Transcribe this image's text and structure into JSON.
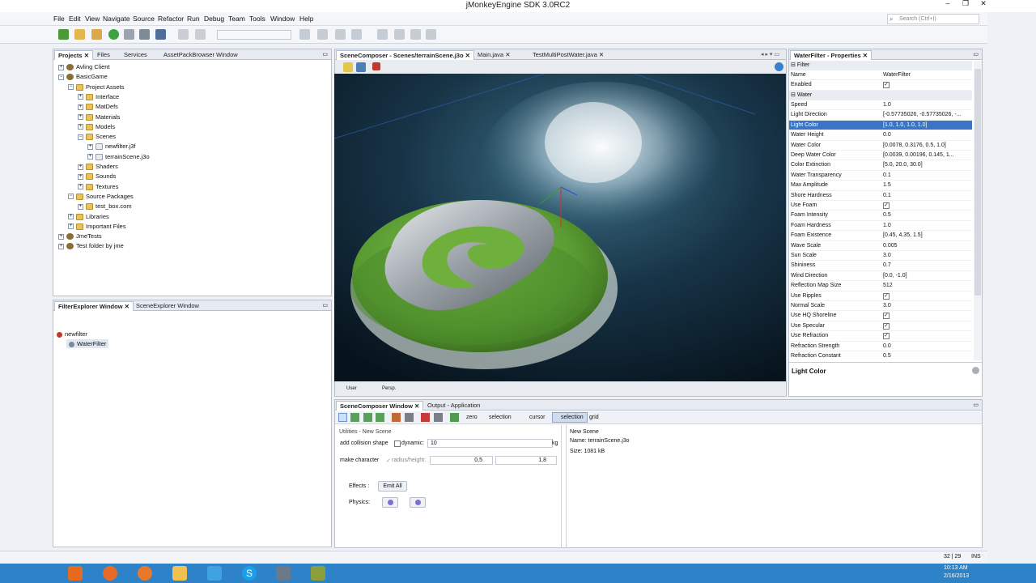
{
  "window": {
    "title": "jMonkeyEngine SDK 3.0RC2",
    "search_placeholder": "Search (Ctrl+I)"
  },
  "menu": [
    "File",
    "Edit",
    "View",
    "Navigate",
    "Source",
    "Refactor",
    "Run",
    "Debug",
    "Team",
    "Tools",
    "Window",
    "Help"
  ],
  "projects": {
    "tabs": [
      "Projects",
      "Files",
      "Services",
      "AssetPackBrowser Window"
    ],
    "tree": [
      {
        "label": "Avling Client",
        "depth": 0,
        "type": "proj",
        "tg": "+"
      },
      {
        "label": "BasicGame",
        "depth": 0,
        "type": "proj",
        "tg": "−"
      },
      {
        "label": "Project Assets",
        "depth": 1,
        "type": "folder",
        "tg": "−"
      },
      {
        "label": "Interface",
        "depth": 2,
        "type": "folder",
        "tg": "+"
      },
      {
        "label": "MatDefs",
        "depth": 2,
        "type": "folder",
        "tg": "+"
      },
      {
        "label": "Materials",
        "depth": 2,
        "type": "folder",
        "tg": "+"
      },
      {
        "label": "Models",
        "depth": 2,
        "type": "folder",
        "tg": "+"
      },
      {
        "label": "Scenes",
        "depth": 2,
        "type": "folder",
        "tg": "−"
      },
      {
        "label": "newfilter.j3f",
        "depth": 3,
        "type": "file",
        "tg": "+"
      },
      {
        "label": "terrainScene.j3o",
        "depth": 3,
        "type": "file",
        "tg": "+"
      },
      {
        "label": "Shaders",
        "depth": 2,
        "type": "folder",
        "tg": "+"
      },
      {
        "label": "Sounds",
        "depth": 2,
        "type": "folder",
        "tg": "+"
      },
      {
        "label": "Textures",
        "depth": 2,
        "type": "folder",
        "tg": "+"
      },
      {
        "label": "Source Packages",
        "depth": 1,
        "type": "folder",
        "tg": "−"
      },
      {
        "label": "test_box.com",
        "depth": 2,
        "type": "folder",
        "tg": "+"
      },
      {
        "label": "Libraries",
        "depth": 1,
        "type": "folder",
        "tg": "+"
      },
      {
        "label": "Important Files",
        "depth": 1,
        "type": "folder",
        "tg": "+"
      },
      {
        "label": "JmeTests",
        "depth": 0,
        "type": "proj",
        "tg": "+"
      },
      {
        "label": "Test folder by jme",
        "depth": 0,
        "type": "proj",
        "tg": "+"
      }
    ]
  },
  "filter_explorer": {
    "tabs": [
      "FilterExplorer Window",
      "SceneExplorer Window"
    ],
    "root": "newfilter",
    "child": "WaterFilter"
  },
  "editor": {
    "tabs": [
      "SceneComposer - Scenes/terrainScene.j3o",
      "Main.java",
      "TestMultiPostWater.java"
    ],
    "bottom_tabs": [
      "User",
      "Persp."
    ]
  },
  "properties": {
    "title": "WaterFilter - Properties",
    "sections": {
      "filter": "Filter",
      "water": "Water"
    },
    "name_row": {
      "name": "Name",
      "value": "WaterFilter"
    },
    "enabled_row": {
      "name": "Enabled",
      "value": "✓"
    },
    "rows": [
      {
        "name": "Speed",
        "value": "1.0"
      },
      {
        "name": "Light Direction",
        "value": "[-0.57735026, -0.57735026, -..."
      },
      {
        "name": "Light Color",
        "value": "[1.0, 1.0, 1.0, 1.0]",
        "selected": true
      },
      {
        "name": "Water Height",
        "value": "0.0"
      },
      {
        "name": "Water Color",
        "value": "[0.0078, 0.3176, 0.5, 1.0]"
      },
      {
        "name": "Deep Water Color",
        "value": "[0.0039, 0.00196, 0.145, 1..."
      },
      {
        "name": "Color Extinction",
        "value": "[5.0, 20.0, 30.0]"
      },
      {
        "name": "Water Transparency",
        "value": "0.1"
      },
      {
        "name": "Max Amplitude",
        "value": "1.5"
      },
      {
        "name": "Shore Hardness",
        "value": "0.1"
      },
      {
        "name": "Use Foam",
        "value": "✓",
        "check": true
      },
      {
        "name": "Foam Intensity",
        "value": "0.5"
      },
      {
        "name": "Foam Hardness",
        "value": "1.0"
      },
      {
        "name": "Foam Existence",
        "value": "[0.45, 4.35, 1.5]"
      },
      {
        "name": "Wave Scale",
        "value": "0.005"
      },
      {
        "name": "Sun Scale",
        "value": "3.0"
      },
      {
        "name": "Shininess",
        "value": "0.7"
      },
      {
        "name": "Wind Direction",
        "value": "[0.0, -1.0]"
      },
      {
        "name": "Reflection Map Size",
        "value": "512"
      },
      {
        "name": "Use Ripples",
        "value": "✓",
        "check": true
      },
      {
        "name": "Normal Scale",
        "value": "3.0"
      },
      {
        "name": "Use HQ Shoreline",
        "value": "✓",
        "check": true
      },
      {
        "name": "Use Specular",
        "value": "✓",
        "check": true
      },
      {
        "name": "Use Refraction",
        "value": "✓",
        "check": true
      },
      {
        "name": "Refraction Strength",
        "value": "0.0"
      },
      {
        "name": "Refraction Constant",
        "value": "0.5"
      }
    ],
    "description_title": "Light Color"
  },
  "composer": {
    "tabs": [
      "SceneComposer Window",
      "Output - Application"
    ],
    "toolbar": {
      "zero": "zero",
      "selection1": "selection",
      "cursor": "cursor",
      "selection2": "selection",
      "grid": "grid"
    },
    "utilities_title": "Utilities - New Scene",
    "collision_label": "add collision shape",
    "dynamic_label": "dynamic:",
    "dynamic_value": "10",
    "kg": "kg",
    "character_label": "make character",
    "radius_label": "radius/height:",
    "radius_value": "0,5",
    "height_value": "1,8",
    "effects_label": "Effects :",
    "emit_all": "Emit All",
    "physics_label": "Physics:",
    "info_title": "New Scene",
    "info_name": "Name: terrainScene.j3o",
    "info_size": "Size: 1081 kB"
  },
  "status": {
    "position": "32 | 29",
    "mode": "INS"
  },
  "taskbar": {
    "time": "10:13 AM",
    "date": "2/16/2013"
  }
}
